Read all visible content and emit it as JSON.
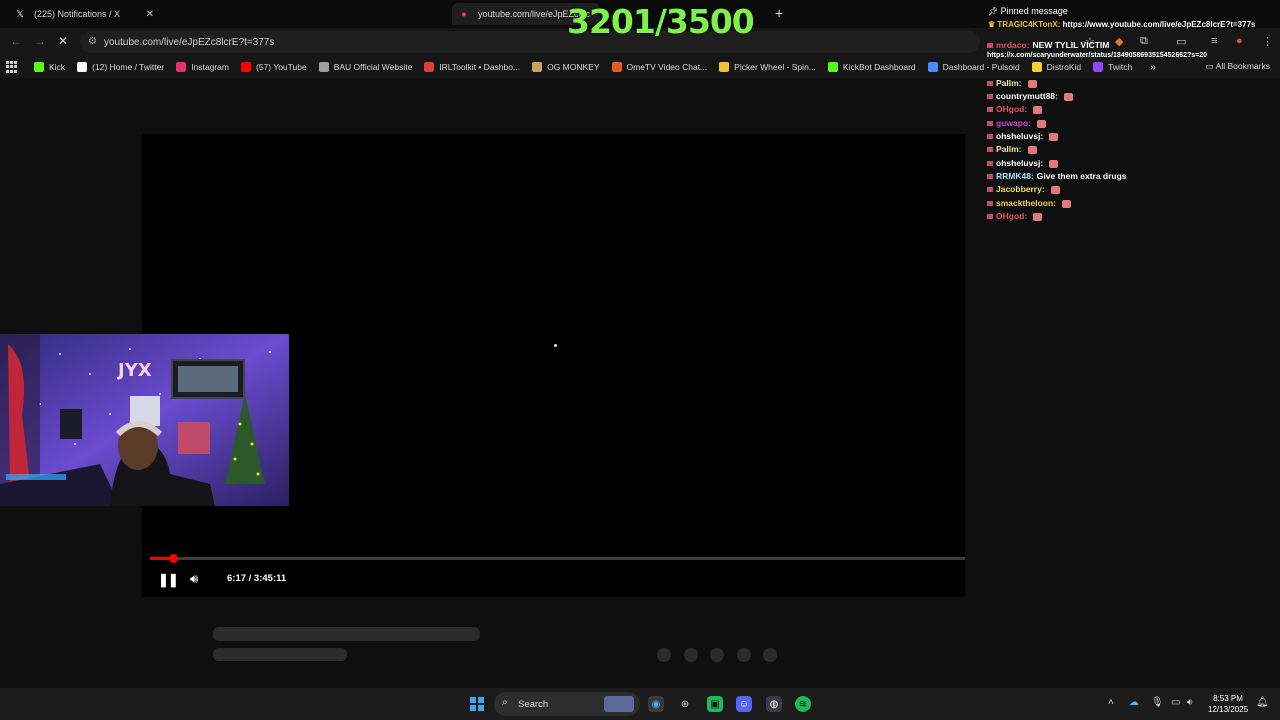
{
  "browser": {
    "tabs": [
      {
        "title": "(225) Notifications / X",
        "favicon": "x-logo-icon"
      },
      {
        "title": "youtube.com/live/eJpEZc8lc",
        "favicon": "youtube-icon"
      }
    ],
    "url": "youtube.com/live/eJpEZc8lcrE?t=377s",
    "bookmarks": [
      {
        "label": "Kick",
        "color": "#53fc18"
      },
      {
        "label": "(12) Home / Twitter",
        "color": "#ffffff"
      },
      {
        "label": "Instagram",
        "color": "#e1306c"
      },
      {
        "label": "(57) YouTube",
        "color": "#ff0000"
      },
      {
        "label": "BAU Official Website",
        "color": "#9aa0a6"
      },
      {
        "label": "IRLToolkit • Dashbo...",
        "color": "#e03a3a"
      },
      {
        "label": "OG MONKEY",
        "color": "#c8a060"
      },
      {
        "label": "OmeTV Video Chat...",
        "color": "#e05a2a"
      },
      {
        "label": "Picker Wheel - Spin...",
        "color": "#f2c12e"
      },
      {
        "label": "KickBot Dashboard",
        "color": "#53fc18"
      },
      {
        "label": "Dashboard - Pulsoid",
        "color": "#4a8cff"
      },
      {
        "label": "DistroKid",
        "color": "#f2d12e"
      },
      {
        "label": "Twitch",
        "color": "#9146ff"
      }
    ],
    "all_bookmarks": "All Bookmarks"
  },
  "player": {
    "time": "6:17 / 3:45:11",
    "progress_fraction": 0.0279,
    "pause_icon": "pause-icon",
    "volume_icon": "volume-icon"
  },
  "overlay": {
    "counter": "3201/3500"
  },
  "chat": {
    "pinned_title": "Pinned message",
    "pinned_user": "TRAGIC4KTonX:",
    "pinned_text": "https://www.youtube.com/live/eJpEZc8lcrE?t=377s",
    "tweet_url": "https://x.com/scaryunderwater/status/1849058693515452662?s=20",
    "lines": [
      {
        "user": "mrdaco:",
        "text": "NEW TYLIL VICTIM",
        "color": "#e0506a"
      },
      {
        "user": "Pallm:",
        "text": "",
        "color": "#f0e6a0"
      },
      {
        "user": "countrymutt88:",
        "text": "",
        "color": "#ffffff"
      },
      {
        "user": "OHgod:",
        "text": "",
        "color": "#e0506a"
      },
      {
        "user": "guwapo:",
        "text": "",
        "color": "#c04ad0"
      },
      {
        "user": "ohsheluvsj:",
        "text": "",
        "color": "#ffffff"
      },
      {
        "user": "Pallm:",
        "text": "",
        "color": "#f0e6a0"
      },
      {
        "user": "ohsheluvsj:",
        "text": "",
        "color": "#ffffff"
      },
      {
        "user": "RRMK48:",
        "text": "Give them extra drugs",
        "color": "#a0e0ff"
      },
      {
        "user": "Jacobberry:",
        "text": "",
        "color": "#f0e060"
      },
      {
        "user": "smacktheloon:",
        "text": "",
        "color": "#f0d060"
      },
      {
        "user": "OHgod:",
        "text": "",
        "color": "#e0506a"
      }
    ]
  },
  "taskbar": {
    "search_label": "Search",
    "time": "8:53 PM",
    "date": "12/13/2025"
  }
}
